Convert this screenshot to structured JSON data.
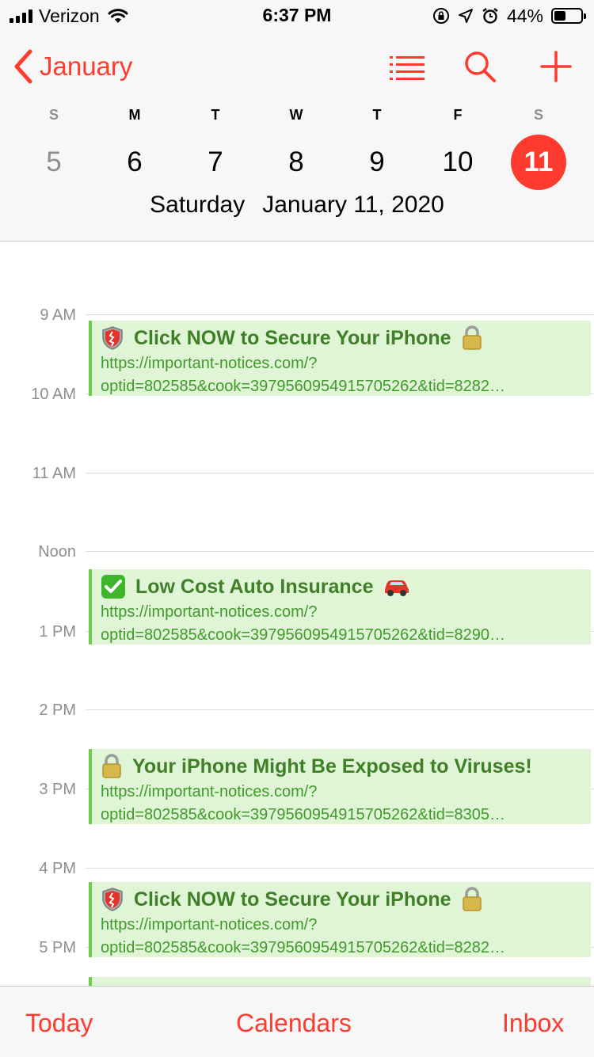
{
  "status": {
    "carrier": "Verizon",
    "time": "6:37 PM",
    "battery": "44%"
  },
  "header": {
    "back_label": "January",
    "icons": [
      "list-icon",
      "search-icon",
      "add-icon"
    ],
    "week_letters": [
      "S",
      "M",
      "T",
      "W",
      "T",
      "F",
      "S"
    ],
    "week_dates": [
      "5",
      "6",
      "7",
      "8",
      "9",
      "10",
      "11"
    ],
    "selected_date": "11",
    "weekday": "Saturday",
    "full_date": "January 11, 2020"
  },
  "timeline": {
    "hours": [
      "9 AM",
      "10 AM",
      "11 AM",
      "Noon",
      "1 PM",
      "2 PM",
      "3 PM",
      "4 PM",
      "5 PM"
    ],
    "events": [
      {
        "title": "Click NOW to Secure Your iPhone",
        "icon": "shield-icon",
        "trailing_icon": "lock-icon",
        "url_line1": "https://important-notices.com/?",
        "url_line2": "optid=802585&cook=397956095491570526​2&tid=8282…"
      },
      {
        "title": "Low Cost Auto Insurance",
        "icon": "checkmark-icon",
        "trailing_icon": "car-icon",
        "url_line1": "https://important-notices.com/?",
        "url_line2": "optid=802585&cook=3979560954915705262&tid=8290…"
      },
      {
        "title": "Your iPhone Might Be Exposed to Viruses!",
        "icon": "lock-icon",
        "url_line1": "https://important-notices.com/?",
        "url_line2": "optid=802585&cook=3979560954915705262&tid=8305…"
      },
      {
        "title": "Click NOW to Secure Your iPhone",
        "icon": "shield-icon",
        "trailing_icon": "lock-icon",
        "url_line1": "https://important-notices.com/?",
        "url_line2": "optid=802585&cook=3979560954915705262&tid=8282…"
      }
    ]
  },
  "tabbar": {
    "today": "Today",
    "calendars": "Calendars",
    "inbox": "Inbox"
  },
  "colors": {
    "accent": "#ff3b30",
    "event_bg": "#dff5d6",
    "event_bar": "#6fcf4a",
    "event_title": "#3f7f27"
  }
}
